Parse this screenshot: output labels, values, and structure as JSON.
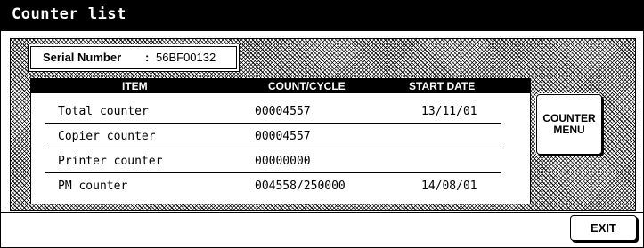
{
  "window": {
    "title": "Counter list"
  },
  "serial": {
    "label": "Serial Number",
    "separator": ":",
    "value": "56BF00132"
  },
  "table": {
    "headers": {
      "item": "ITEM",
      "count": "COUNT/CYCLE",
      "start_date": "START DATE"
    },
    "rows": [
      {
        "item": "Total counter",
        "count": "00004557",
        "start_date": "13/11/01"
      },
      {
        "item": "Copier counter",
        "count": "00004557",
        "start_date": ""
      },
      {
        "item": "Printer counter",
        "count": "00000000",
        "start_date": ""
      },
      {
        "item": "PM counter",
        "count": "004558/250000",
        "start_date": "14/08/01"
      }
    ]
  },
  "buttons": {
    "counter_menu_line1": "COUNTER",
    "counter_menu_line2": "MENU",
    "exit": "EXIT"
  }
}
